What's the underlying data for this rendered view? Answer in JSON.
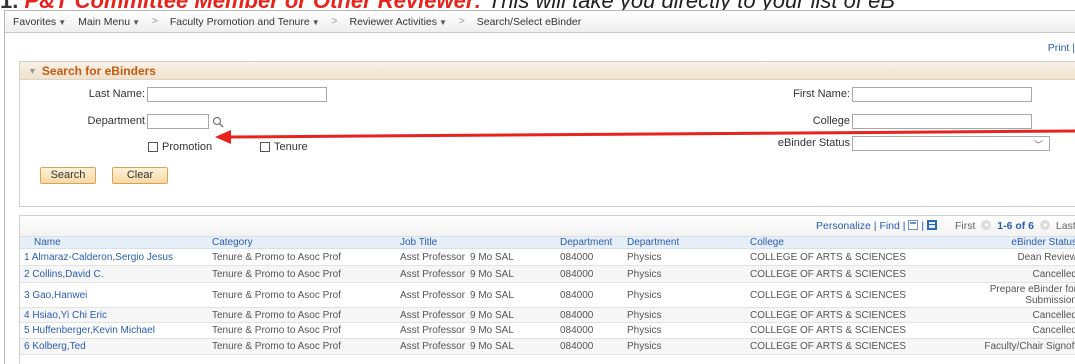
{
  "banner": {
    "number": "1.",
    "highlight": "P&T Committee Member or Other Reviewer:",
    "rest": "This will take you directly to your list of eB"
  },
  "navbar": {
    "favorites": "Favorites",
    "main_menu": "Main Menu",
    "faculty": "Faculty Promotion and Tenure",
    "reviewer": "Reviewer Activities",
    "search_select": "Search/Select eBinder"
  },
  "print_link": "Print",
  "search": {
    "title": "Search for eBinders",
    "last_name_label": "Last Name:",
    "last_name_value": "",
    "department_label": "Department",
    "department_value": "",
    "promotion_label": "Promotion",
    "tenure_label": "Tenure",
    "first_name_label": "First Name:",
    "first_name_value": "",
    "college_label": "College",
    "college_value": "",
    "status_label": "eBinder Status",
    "status_value": "",
    "search_button": "Search",
    "clear_button": "Clear"
  },
  "grid": {
    "personalize": "Personalize",
    "find": "Find",
    "first": "First",
    "count": "1-6 of 6",
    "last": "Last",
    "columns": [
      "Name",
      "Category",
      "Job Title",
      "",
      "Department",
      "Department",
      "College",
      "eBinder Status"
    ],
    "rows": [
      {
        "name": "1 Almaraz-Calderon,Sergio Jesus",
        "category": "Tenure & Promo to Asoc Prof",
        "job": "Asst Professor",
        "sal": "9 Mo SAL",
        "dept_id": "084000",
        "dept": "Physics",
        "college": "COLLEGE OF ARTS & SCIENCES",
        "status": "Dean Review"
      },
      {
        "name": "2 Collins,David C.",
        "category": "Tenure & Promo to Asoc Prof",
        "job": "Asst Professor",
        "sal": "9 Mo SAL",
        "dept_id": "084000",
        "dept": "Physics",
        "college": "COLLEGE OF ARTS & SCIENCES",
        "status": "Cancelled"
      },
      {
        "name": "3 Gao,Hanwei",
        "category": "Tenure & Promo to Asoc Prof",
        "job": "Asst Professor",
        "sal": "9 Mo SAL",
        "dept_id": "084000",
        "dept": "Physics",
        "college": "COLLEGE OF ARTS & SCIENCES",
        "status": "Prepare eBinder for Submission"
      },
      {
        "name": "4 Hsiao,Yi Chi Eric",
        "category": "Tenure & Promo to Asoc Prof",
        "job": "Asst Professor",
        "sal": "9 Mo SAL",
        "dept_id": "084000",
        "dept": "Physics",
        "college": "COLLEGE OF ARTS & SCIENCES",
        "status": "Cancelled"
      },
      {
        "name": "5 Huffenberger,Kevin Michael",
        "category": "Tenure & Promo to Asoc Prof",
        "job": "Asst Professor",
        "sal": "9 Mo SAL",
        "dept_id": "084000",
        "dept": "Physics",
        "college": "COLLEGE OF ARTS & SCIENCES",
        "status": "Cancelled"
      },
      {
        "name": "6 Kolberg,Ted",
        "category": "Tenure & Promo to Asoc Prof",
        "job": "Asst Professor",
        "sal": "9 Mo SAL",
        "dept_id": "084000",
        "dept": "Physics",
        "college": "COLLEGE OF ARTS & SCIENCES",
        "status": "Faculty/Chair Signoff"
      }
    ]
  },
  "colors": {
    "accent_orange": "#c55a11",
    "link_blue": "#2a5db0",
    "arrow_red": "#e8231b"
  }
}
